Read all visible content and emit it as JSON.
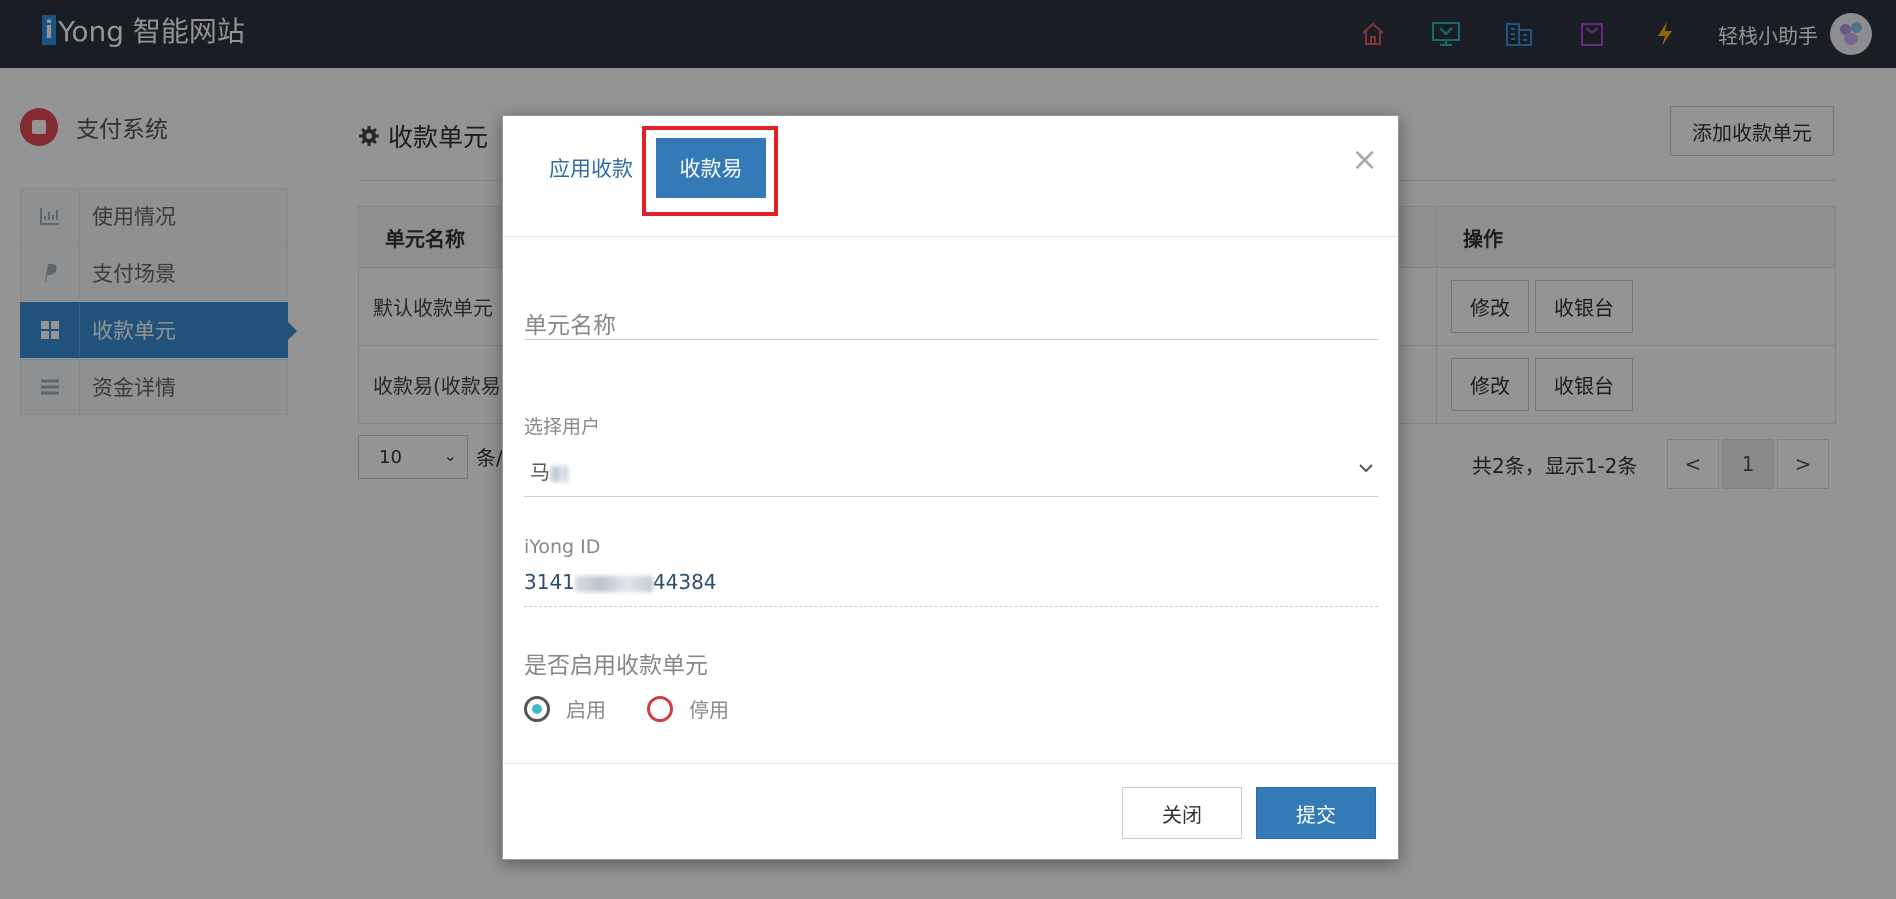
{
  "header": {
    "logo_letter": "i",
    "logo_text": "Yong 智能网站",
    "username": "轻栈小助手",
    "icons": [
      "home-icon",
      "monitor-icon",
      "building-icon",
      "bag-icon",
      "lightning-icon"
    ],
    "icon_colors": {
      "home": "#e05a64",
      "monitor": "#26b8c6",
      "building": "#3d8fe0",
      "bag": "#b14cd6",
      "lightning": "#f5b020"
    }
  },
  "sidebar": {
    "title": "支付系统",
    "items": [
      {
        "label": "使用情况",
        "icon": "bar-chart-icon"
      },
      {
        "label": "支付场景",
        "icon": "paypal-icon"
      },
      {
        "label": "收款单元",
        "icon": "grid-icon",
        "active": true
      },
      {
        "label": "资金详情",
        "icon": "list-icon"
      }
    ]
  },
  "main": {
    "title": "收款单元",
    "add_button": "添加收款单元",
    "table": {
      "col_name": "单元名称",
      "col_ops": "操作",
      "rows": [
        {
          "name": "默认收款单元",
          "edit": "修改",
          "cashier": "收银台"
        },
        {
          "name": "收款易(收款易",
          "edit": "修改",
          "cashier": "收银台"
        }
      ]
    },
    "page_size": "10",
    "page_size_suffix": "条/",
    "pager_info": "共2条，显示1-2条",
    "prev": "<",
    "current_page": "1",
    "next": ">"
  },
  "modal": {
    "tab_app": "应用收款",
    "tab_easy": "收款易",
    "unit_name_placeholder": "单元名称",
    "select_user_label": "选择用户",
    "select_user_value": "马",
    "iyong_id_label": "iYong ID",
    "iyong_id_prefix": "3141",
    "iyong_id_suffix": "44384",
    "enable_label": "是否启用收款单元",
    "radio_on": "启用",
    "radio_off": "停用",
    "close_button": "关闭",
    "submit_button": "提交",
    "close_x": "×"
  }
}
